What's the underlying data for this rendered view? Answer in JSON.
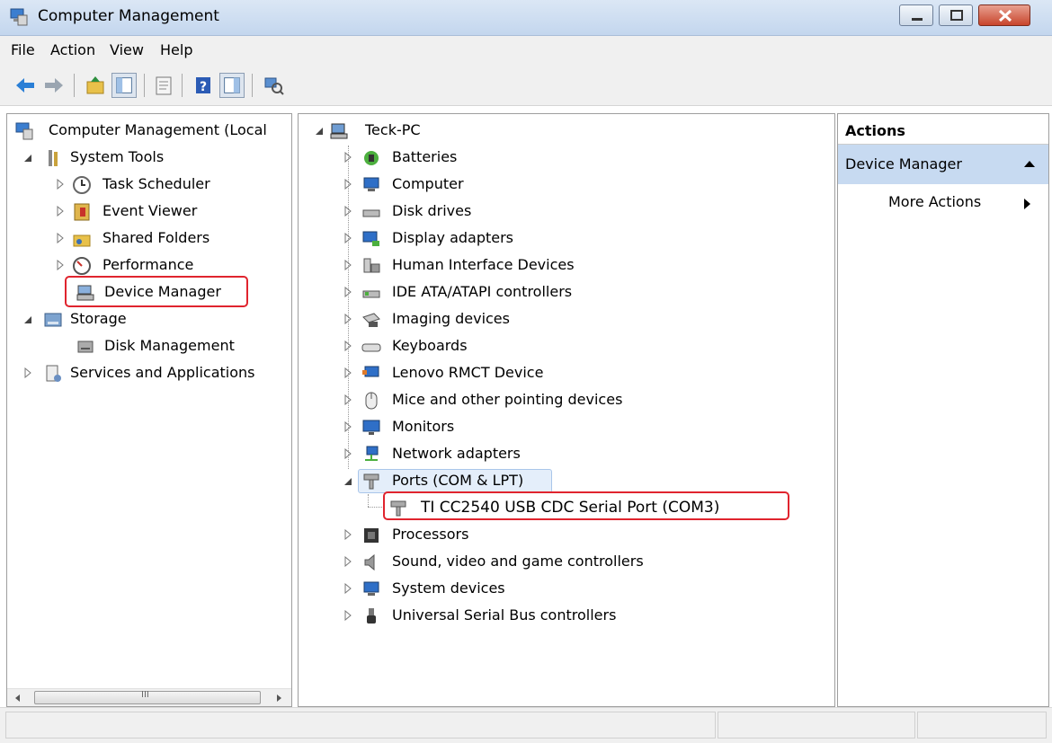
{
  "window": {
    "title": "Computer Management"
  },
  "menu": [
    "File",
    "Action",
    "View",
    "Help"
  ],
  "toolbar": [
    "back-icon",
    "forward-icon",
    "up-folder-icon",
    "show-hide-console-tree-icon",
    "properties-icon",
    "help-icon",
    "show-hide-action-pane-icon",
    "scan-hardware-icon"
  ],
  "left_tree": [
    {
      "label": "Computer Management (Local",
      "icon": "computer-management-icon"
    },
    {
      "label": "System Tools",
      "icon": "system-tools-icon"
    },
    {
      "label": "Task Scheduler",
      "icon": "task-scheduler-icon"
    },
    {
      "label": "Event Viewer",
      "icon": "event-viewer-icon"
    },
    {
      "label": "Shared Folders",
      "icon": "shared-folders-icon"
    },
    {
      "label": "Performance",
      "icon": "performance-icon"
    },
    {
      "label": "Device Manager",
      "icon": "device-manager-icon",
      "selected": true
    },
    {
      "label": "Storage",
      "icon": "storage-icon"
    },
    {
      "label": "Disk Management",
      "icon": "disk-management-icon"
    },
    {
      "label": "Services and Applications",
      "icon": "services-icon"
    }
  ],
  "device_tree": {
    "root": "Teck-PC",
    "categories": [
      "Batteries",
      "Computer",
      "Disk drives",
      "Display adapters",
      "Human Interface Devices",
      "IDE ATA/ATAPI controllers",
      "Imaging devices",
      "Keyboards",
      "Lenovo RMCT Device",
      "Mice and other pointing devices",
      "Monitors",
      "Network adapters",
      "Ports (COM & LPT)",
      "TI CC2540 USB CDC Serial Port (COM3)",
      "Processors",
      "Sound, video and game controllers",
      "System devices",
      "Universal Serial Bus controllers"
    ]
  },
  "actions": {
    "header": "Actions",
    "section": "Device Manager",
    "more": "More Actions"
  },
  "scroll_glyph": "III",
  "colors": {
    "highlight": "#e0242e",
    "selection": "#c7daf1",
    "pane_border": "#9e9e9e"
  }
}
